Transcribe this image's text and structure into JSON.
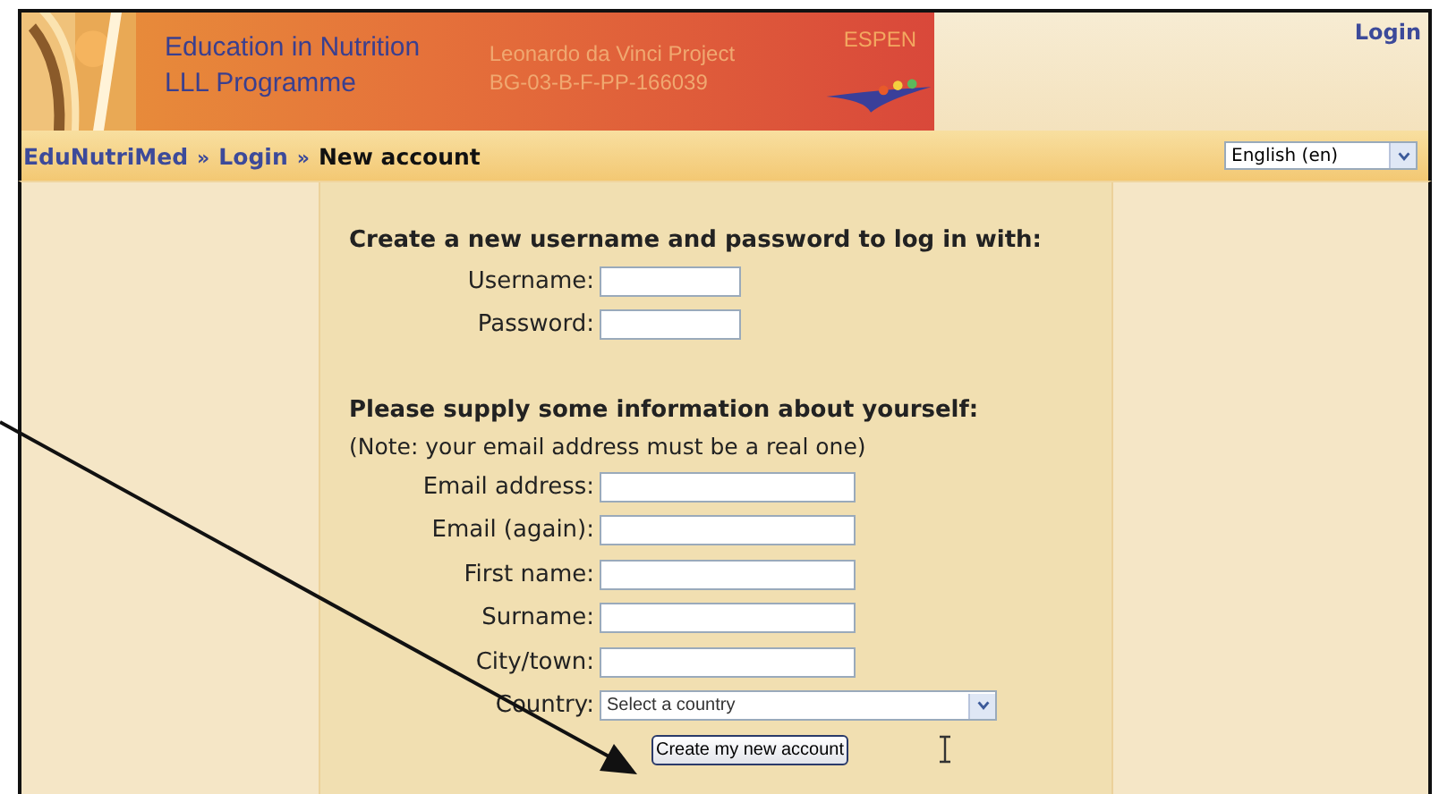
{
  "header": {
    "title_lines": [
      "Education in Nutrition",
      "LLL Programme"
    ],
    "project_lines": [
      "Leonardo da Vinci Project",
      "BG-03-B-F-PP-166039"
    ],
    "partner": "ESPEN",
    "login_link": "Login"
  },
  "breadcrumb": [
    {
      "label": "EduNutriMed",
      "kind": "link"
    },
    {
      "label": "»",
      "kind": "separator"
    },
    {
      "label": "Login",
      "kind": "link"
    },
    {
      "label": "»",
      "kind": "separator"
    },
    {
      "label": "New account",
      "kind": "current"
    }
  ],
  "language_select": {
    "value": "English (en)"
  },
  "form": {
    "sections": [
      {
        "heading": "Create a new username and password to log in with:",
        "fields": [
          {
            "label": "Username:",
            "kind": "short_text"
          },
          {
            "label": "Password:",
            "kind": "short_text"
          }
        ]
      },
      {
        "heading": "Please supply some information about yourself:",
        "note": "(Note: your email address must be a real one)",
        "fields": [
          {
            "label": "Email address:",
            "kind": "text"
          },
          {
            "label": "Email (again):",
            "kind": "text"
          },
          {
            "label": "First name:",
            "kind": "text"
          },
          {
            "label": "Surname:",
            "kind": "text"
          },
          {
            "label": "City/town:",
            "kind": "text"
          },
          {
            "label": "Country:",
            "kind": "select",
            "value": "Select a country"
          }
        ]
      }
    ],
    "submit": "Create my new account"
  }
}
